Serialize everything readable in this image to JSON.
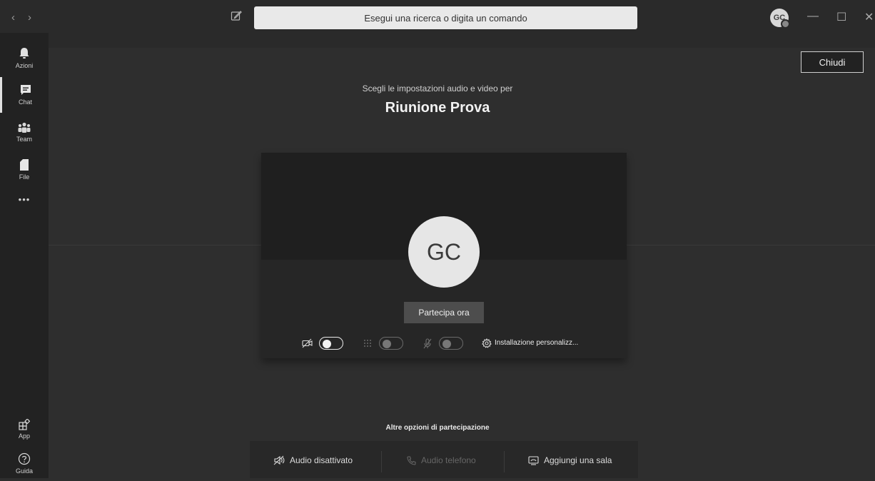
{
  "titlebar": {
    "back_glyph": "‹",
    "forward_glyph": "›",
    "search_placeholder": "Esegui una ricerca o digita un comando",
    "avatar_initials": "GC",
    "minimize_glyph": "—",
    "maximize_glyph": "☐",
    "close_glyph": "✕"
  },
  "sidebar": {
    "items": [
      {
        "label": "Azioni",
        "icon": "bell-icon"
      },
      {
        "label": "Chat",
        "icon": "chat-icon",
        "active": true
      },
      {
        "label": "Team",
        "icon": "team-icon"
      },
      {
        "label": "File",
        "icon": "file-icon"
      },
      {
        "label": "•••",
        "icon": "more-icon"
      }
    ],
    "bottom_items": [
      {
        "label": "App",
        "icon": "apps-icon"
      },
      {
        "label": "Guida",
        "icon": "help-icon"
      }
    ]
  },
  "header": {
    "close_label": "Chiudi",
    "subtitle": "Scegli le impostazioni audio e video per",
    "meeting_title": "Riunione Prova"
  },
  "preview": {
    "avatar_initials": "GC",
    "join_label": "Partecipa ora",
    "video_toggle_on": true,
    "blur_toggle_on": false,
    "mic_toggle_on": false,
    "settings_label": "Installazione personalizz..."
  },
  "other_options": {
    "heading": "Altre opzioni di partecipazione",
    "audio_off": "Audio disattivato",
    "phone_audio": "Audio telefono",
    "add_room": "Aggiungi una sala"
  },
  "colors": {
    "background": "#2e2e2e",
    "sidebar": "#222222",
    "search": "#e9e9e9",
    "preview": "#1f1f1f"
  }
}
